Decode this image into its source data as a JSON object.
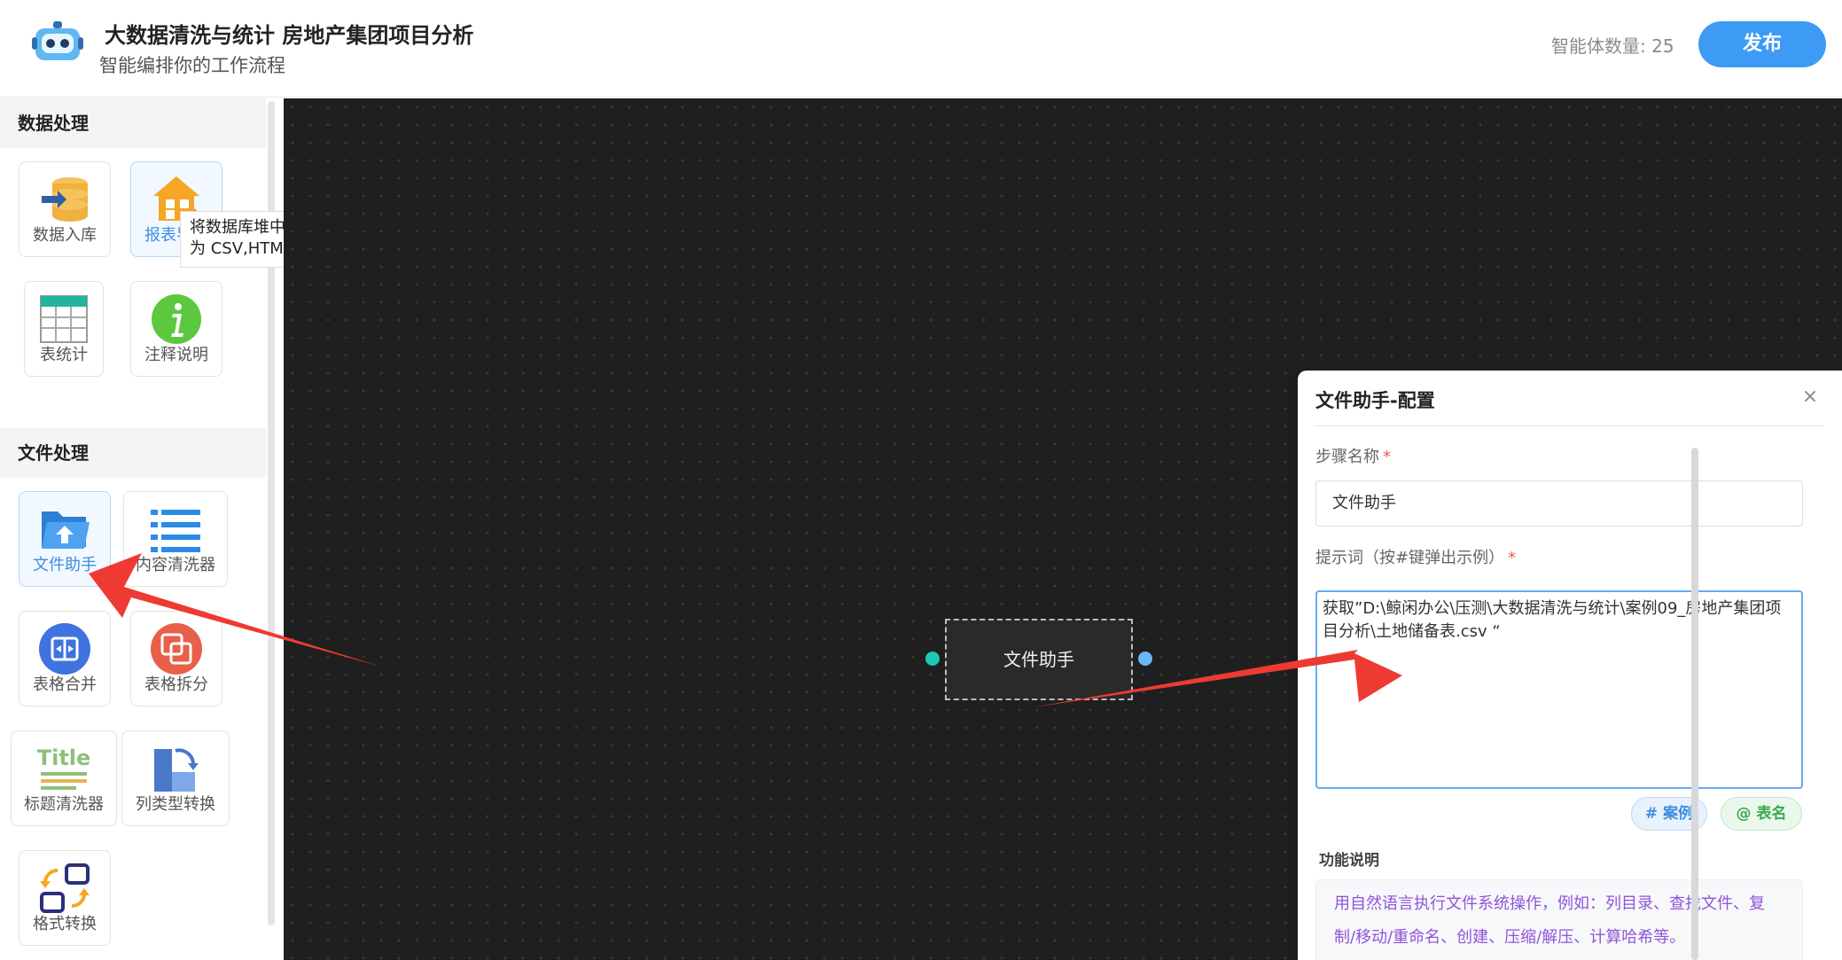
{
  "header": {
    "title": "大数据清洗与统计 房地产集团项目分析",
    "subtitle": "智能编排你的工作流程",
    "agent_count": "智能体数量: 25",
    "publish_label": "发布"
  },
  "sidebar": {
    "sections": [
      {
        "title": "数据处理"
      },
      {
        "title": "文件处理"
      }
    ],
    "tools": [
      {
        "label": "数据入库",
        "icon": "database-import-icon"
      },
      {
        "label": "报表导出",
        "icon": "report-export-icon"
      },
      {
        "label": "表统计",
        "icon": "table-grid-icon"
      },
      {
        "label": "注释说明",
        "icon": "info-icon"
      },
      {
        "label": "文件助手",
        "icon": "folder-upload-icon"
      },
      {
        "label": "内容清洗器",
        "icon": "list-lines-icon"
      },
      {
        "label": "表格合并",
        "icon": "merge-icon"
      },
      {
        "label": "表格拆分",
        "icon": "split-icon"
      },
      {
        "label": "标题清洗器",
        "icon": "title-icon"
      },
      {
        "label": "列类型转换",
        "icon": "column-convert-icon"
      },
      {
        "label": "格式转换",
        "icon": "format-convert-icon"
      }
    ],
    "tooltip": "将数据库堆中的表导出为 CSV,HTML文件"
  },
  "canvas": {
    "node_label": "文件助手"
  },
  "panel": {
    "title": "文件助手-配置",
    "close_symbol": "×",
    "step_name_label": "步骤名称",
    "required_mark": "*",
    "step_name_value": "文件助手",
    "prompt_label": "提示词（按#键弹出示例）",
    "prompt_value": "获取”D:\\鲸闲办公\\压测\\大数据清洗与统计\\案例09_房地产集团项目分析\\土地储备表.csv “",
    "chip_case": "# 案例",
    "chip_table": "@ 表名",
    "desc_title": "功能说明",
    "desc_text": "用自然语言执行文件系统操作，例如：列目录、查找文件、复制/移动/重命名、创建、压缩/解压、计算哈希等。"
  },
  "colors": {
    "accent": "#3d9bf5",
    "canvas_bg": "#1f1f1f",
    "arrow": "#ee3a33",
    "desc_text": "#9154d9"
  }
}
